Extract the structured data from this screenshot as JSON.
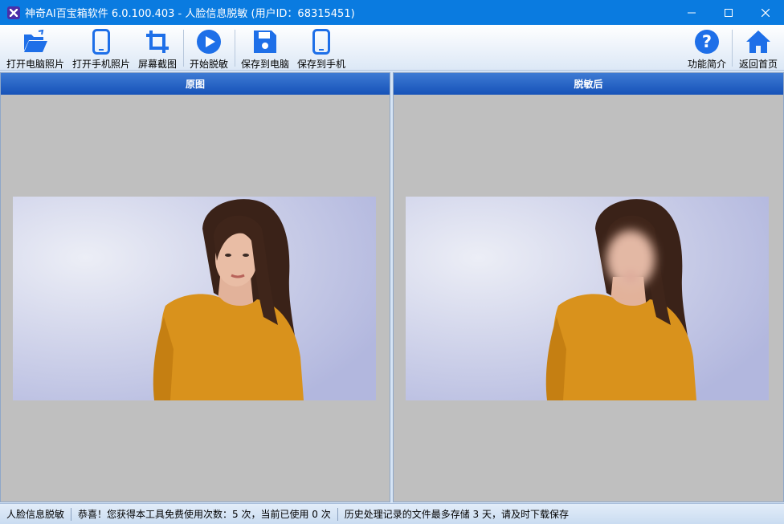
{
  "window": {
    "title": "神奇AI百宝箱软件 6.0.100.403 - 人脸信息脱敏 (用户ID：68315451)"
  },
  "toolbar": {
    "open_pc_photo": "打开电脑照片",
    "open_phone_photo": "打开手机照片",
    "screenshot": "屏幕截图",
    "start": "开始脱敏",
    "save_pc": "保存到电脑",
    "save_phone": "保存到手机",
    "help": "功能简介",
    "home": "返回首页"
  },
  "panels": {
    "original_title": "原图",
    "result_title": "脱敏后"
  },
  "status": {
    "tool_name": "人脸信息脱敏",
    "usage": "恭喜！您获得本工具免费使用次数：5 次，当前已使用 0 次",
    "note": "历史处理记录的文件最多存储 3 天，请及时下载保存"
  },
  "colors": {
    "titlebar": "#0a7be0",
    "icon_blue": "#1e6fe8",
    "panel_header": "#1652b8",
    "panel_bg": "#bfbfbf",
    "sweater": "#d9921c"
  }
}
